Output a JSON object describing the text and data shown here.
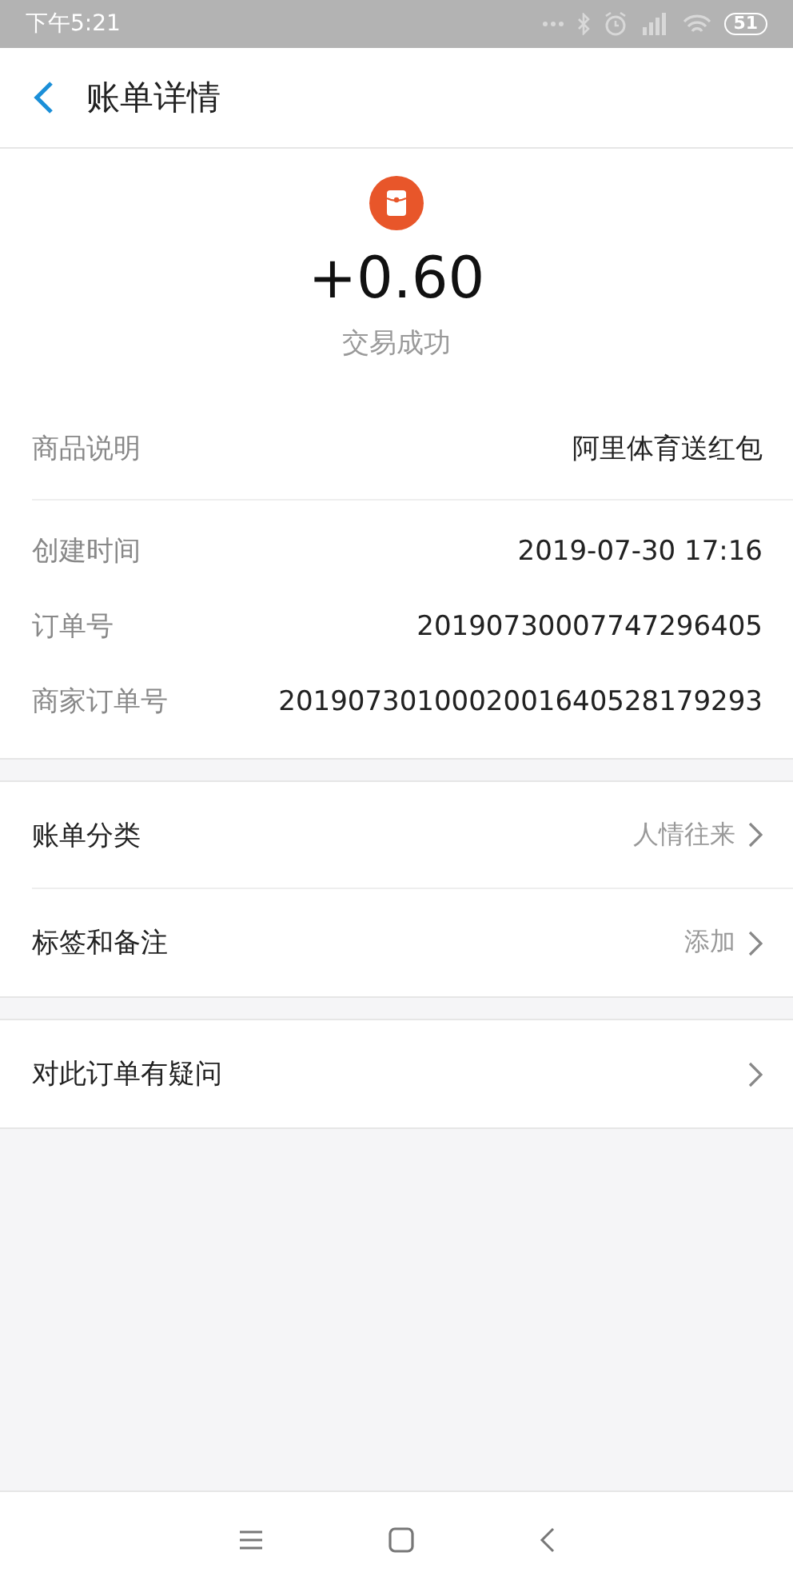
{
  "status_bar": {
    "time": "下午5:21",
    "battery": "51"
  },
  "header": {
    "title": "账单详情"
  },
  "summary": {
    "amount": "+0.60",
    "status": "交易成功"
  },
  "product": {
    "label": "商品说明",
    "value": "阿里体育送红包"
  },
  "order_details": [
    {
      "label": "创建时间",
      "value": "2019-07-30 17:16"
    },
    {
      "label": "订单号",
      "value": "20190730007747296405"
    },
    {
      "label": "商家订单号",
      "value": "2019073010002001640528179293"
    }
  ],
  "link_groups": [
    [
      {
        "label": "账单分类",
        "value": "人情往来"
      },
      {
        "label": "标签和备注",
        "value": "添加"
      }
    ],
    [
      {
        "label": "对此订单有疑问"
      }
    ]
  ]
}
